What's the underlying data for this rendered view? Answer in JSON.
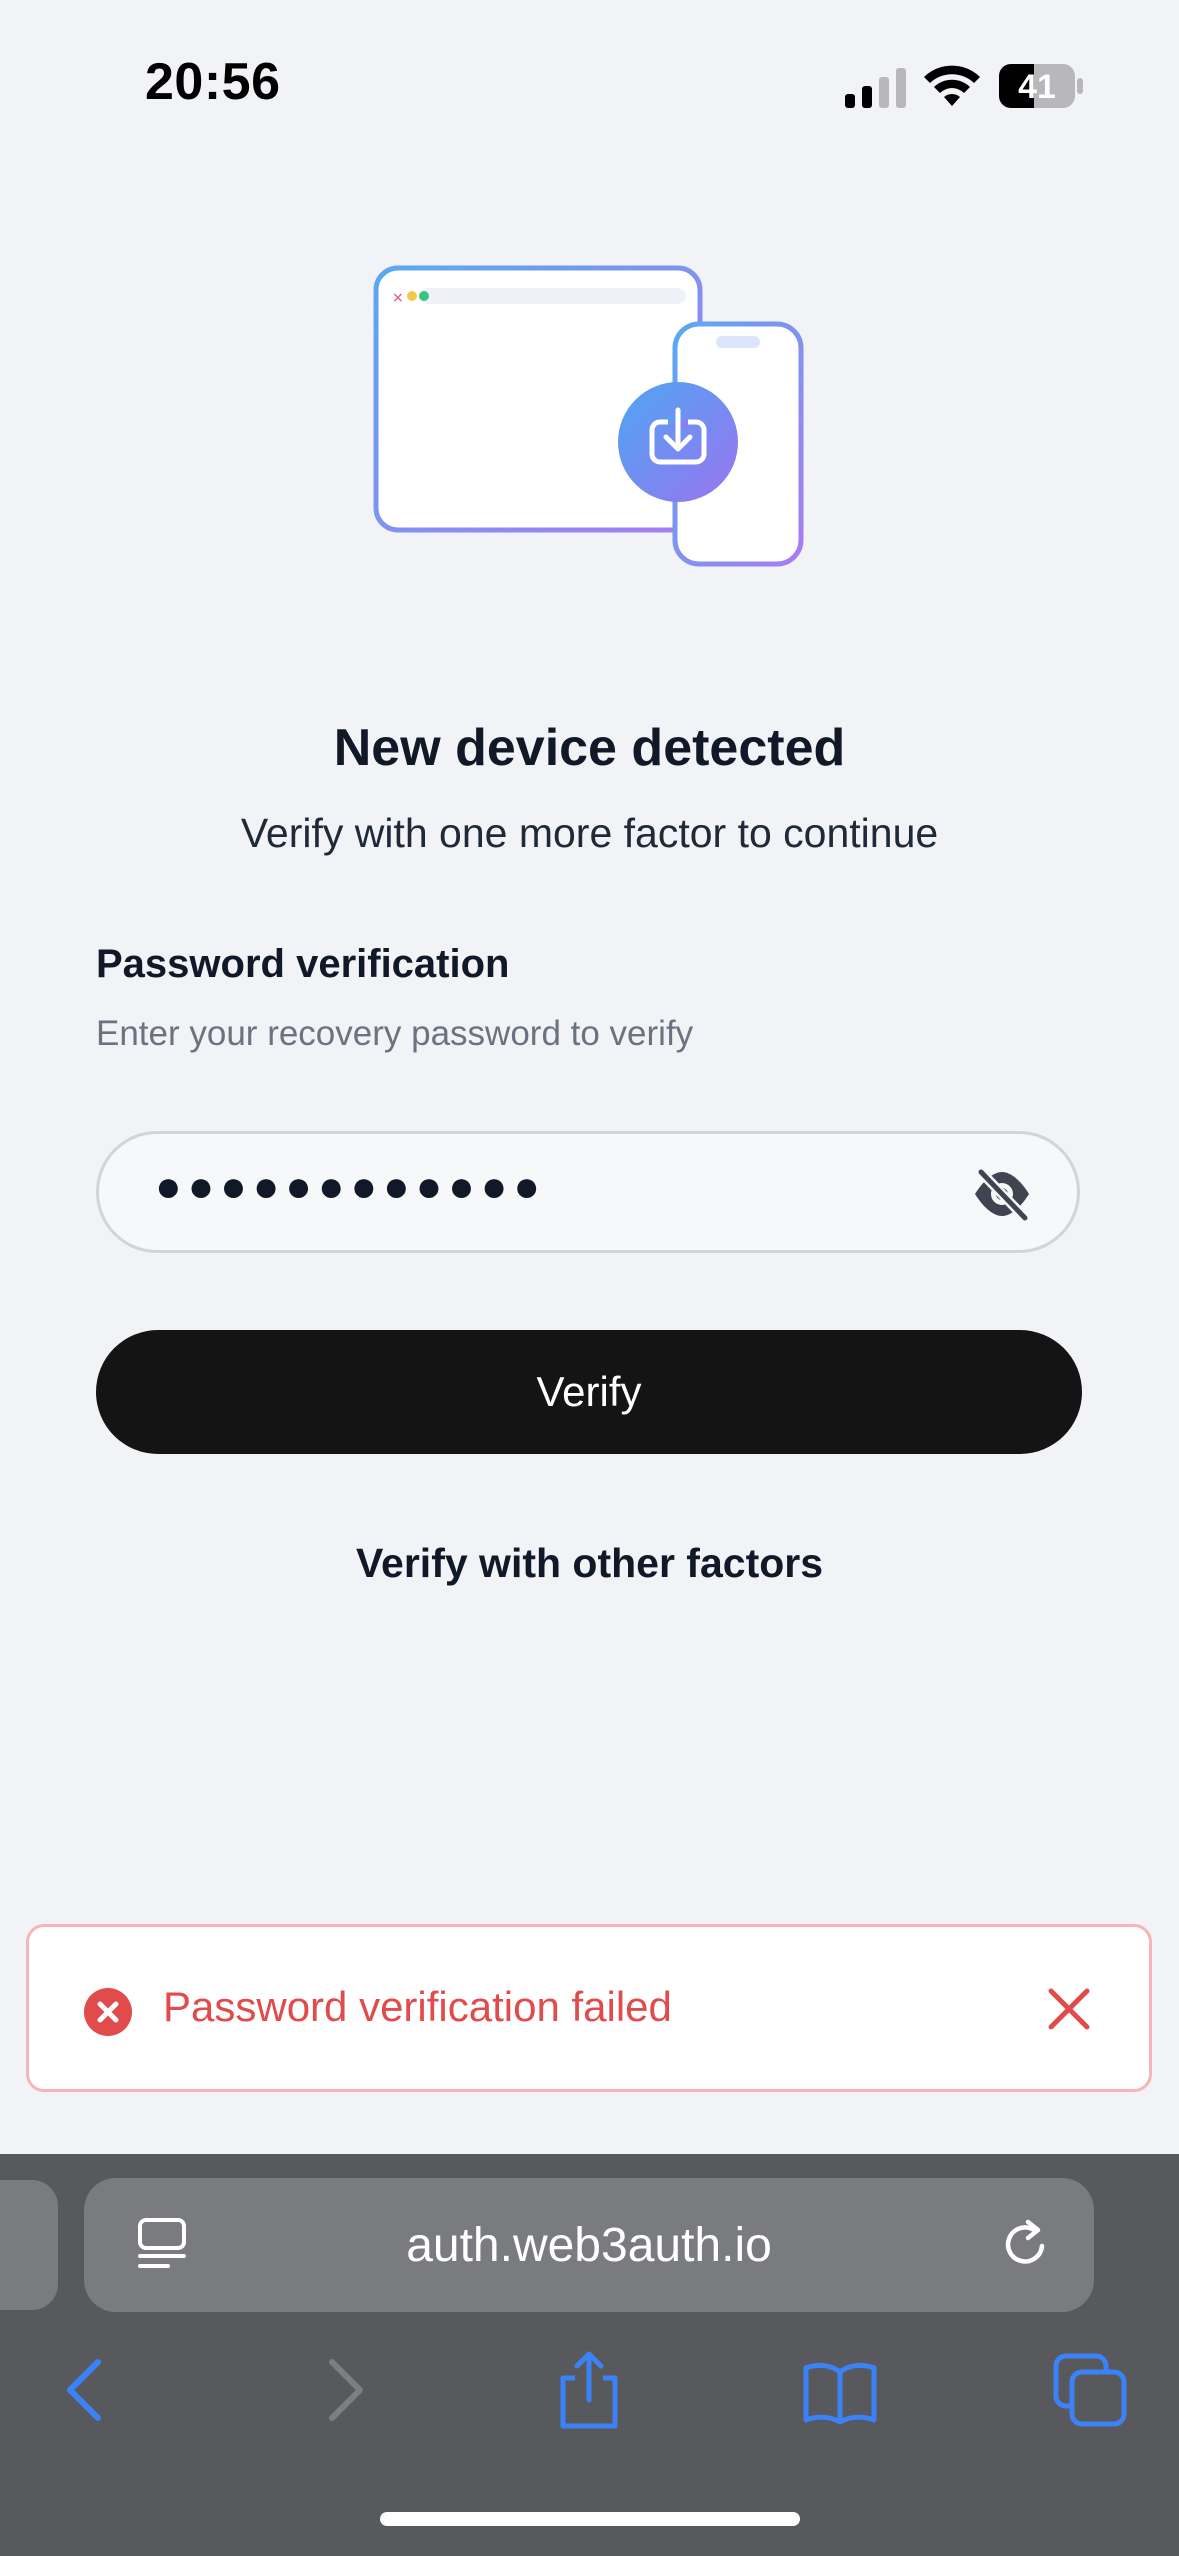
{
  "status": {
    "time": "20:56",
    "battery": "41"
  },
  "main": {
    "title": "New device detected",
    "subtitle": "Verify with one more factor to continue",
    "section_label": "Password verification",
    "section_hint": "Enter your recovery password to verify",
    "password_masked": "●●●●●●●●●●●●",
    "verify_label": "Verify",
    "other_factors_label": "Verify with other factors"
  },
  "toast": {
    "message": "Password verification failed"
  },
  "browser": {
    "url": "auth.web3auth.io"
  },
  "colors": {
    "accent_blue": "#3b82f6",
    "error_red": "#e14b4b",
    "button_dark": "#141414"
  }
}
